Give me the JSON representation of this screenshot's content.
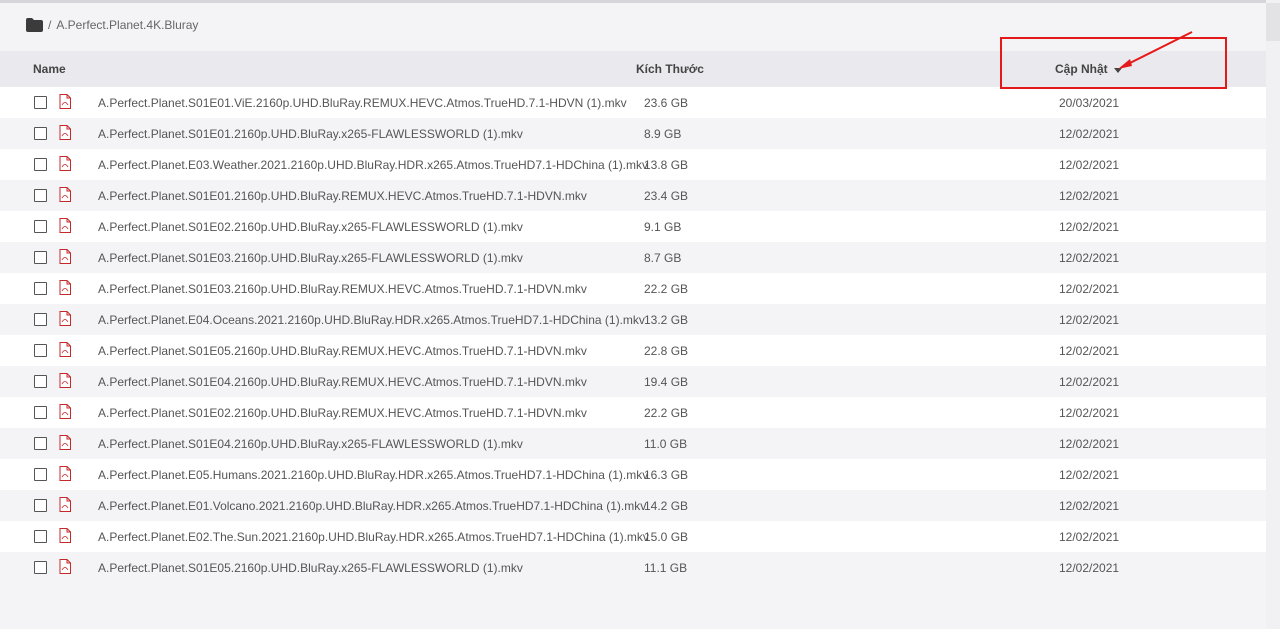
{
  "breadcrumb": {
    "icon": "folder-icon",
    "separator": "/",
    "folder_name": "A.Perfect.Planet.4K.Bluray"
  },
  "table": {
    "headers": {
      "name": "Name",
      "size": "Kích Thước",
      "updated": "Cập Nhật"
    },
    "sort": {
      "column": "updated",
      "direction": "desc",
      "icon": "caret-down-icon"
    },
    "rows": [
      {
        "name": "A.Perfect.Planet.S01E01.ViE.2160p.UHD.BluRay.REMUX.HEVC.Atmos.TrueHD.7.1-HDVN (1).mkv",
        "size": "23.6 GB",
        "date": "20/03/2021"
      },
      {
        "name": "A.Perfect.Planet.S01E01.2160p.UHD.BluRay.x265-FLAWLESSWORLD (1).mkv",
        "size": "8.9 GB",
        "date": "12/02/2021"
      },
      {
        "name": "A.Perfect.Planet.E03.Weather.2021.2160p.UHD.BluRay.HDR.x265.Atmos.TrueHD7.1-HDChina (1).mkv",
        "size": "13.8 GB",
        "date": "12/02/2021"
      },
      {
        "name": "A.Perfect.Planet.S01E01.2160p.UHD.BluRay.REMUX.HEVC.Atmos.TrueHD.7.1-HDVN.mkv",
        "size": "23.4 GB",
        "date": "12/02/2021"
      },
      {
        "name": "A.Perfect.Planet.S01E02.2160p.UHD.BluRay.x265-FLAWLESSWORLD (1).mkv",
        "size": "9.1 GB",
        "date": "12/02/2021"
      },
      {
        "name": "A.Perfect.Planet.S01E03.2160p.UHD.BluRay.x265-FLAWLESSWORLD (1).mkv",
        "size": "8.7 GB",
        "date": "12/02/2021"
      },
      {
        "name": "A.Perfect.Planet.S01E03.2160p.UHD.BluRay.REMUX.HEVC.Atmos.TrueHD.7.1-HDVN.mkv",
        "size": "22.2 GB",
        "date": "12/02/2021"
      },
      {
        "name": "A.Perfect.Planet.E04.Oceans.2021.2160p.UHD.BluRay.HDR.x265.Atmos.TrueHD7.1-HDChina (1).mkv",
        "size": "13.2 GB",
        "date": "12/02/2021"
      },
      {
        "name": "A.Perfect.Planet.S01E05.2160p.UHD.BluRay.REMUX.HEVC.Atmos.TrueHD.7.1-HDVN.mkv",
        "size": "22.8 GB",
        "date": "12/02/2021"
      },
      {
        "name": "A.Perfect.Planet.S01E04.2160p.UHD.BluRay.REMUX.HEVC.Atmos.TrueHD.7.1-HDVN.mkv",
        "size": "19.4 GB",
        "date": "12/02/2021"
      },
      {
        "name": "A.Perfect.Planet.S01E02.2160p.UHD.BluRay.REMUX.HEVC.Atmos.TrueHD.7.1-HDVN.mkv",
        "size": "22.2 GB",
        "date": "12/02/2021"
      },
      {
        "name": "A.Perfect.Planet.S01E04.2160p.UHD.BluRay.x265-FLAWLESSWORLD (1).mkv",
        "size": "11.0 GB",
        "date": "12/02/2021"
      },
      {
        "name": "A.Perfect.Planet.E05.Humans.2021.2160p.UHD.BluRay.HDR.x265.Atmos.TrueHD7.1-HDChina (1).mkv",
        "size": "16.3 GB",
        "date": "12/02/2021"
      },
      {
        "name": "A.Perfect.Planet.E01.Volcano.2021.2160p.UHD.BluRay.HDR.x265.Atmos.TrueHD7.1-HDChina (1).mkv",
        "size": "14.2 GB",
        "date": "12/02/2021"
      },
      {
        "name": "A.Perfect.Planet.E02.The.Sun.2021.2160p.UHD.BluRay.HDR.x265.Atmos.TrueHD7.1-HDChina (1).mkv",
        "size": "15.0 GB",
        "date": "12/02/2021"
      },
      {
        "name": "A.Perfect.Planet.S01E05.2160p.UHD.BluRay.x265-FLAWLESSWORLD (1).mkv",
        "size": "11.1 GB",
        "date": "12/02/2021"
      }
    ],
    "row_icon": "pdf-file-icon"
  },
  "colors": {
    "accent_annotation": "#e41a1a",
    "file_icon": "#c62828",
    "header_bg": "#eaeaee"
  }
}
